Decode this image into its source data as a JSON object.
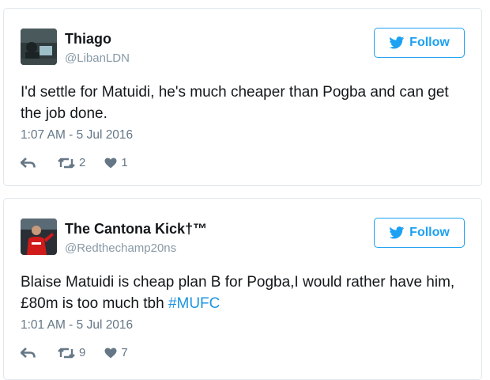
{
  "tweets": [
    {
      "name": "Thiago",
      "handle": "@LibanLDN",
      "follow_label": "Follow",
      "text": "I'd settle for Matuidi, he's much cheaper than Pogba and can get the job done.",
      "hashtag": "",
      "timestamp": "1:07 AM - 5 Jul 2016",
      "retweets": "2",
      "likes": "1"
    },
    {
      "name": "The Cantona Kick†™",
      "handle": "@Redthechamp20ns",
      "follow_label": "Follow",
      "text": "Blaise Matuidi is cheap plan B for Pogba,I would rather have him,£80m is too much tbh ",
      "hashtag": "#MUFC",
      "timestamp": "1:01 AM - 5 Jul 2016",
      "retweets": "9",
      "likes": "7"
    }
  ],
  "colors": {
    "brand": "#1da1f2",
    "hashtag": "#1b95e0",
    "muted": "#657786",
    "border": "#e1e8ed"
  },
  "icons": [
    "twitter-bird-icon",
    "reply-icon",
    "retweet-icon",
    "heart-icon"
  ]
}
